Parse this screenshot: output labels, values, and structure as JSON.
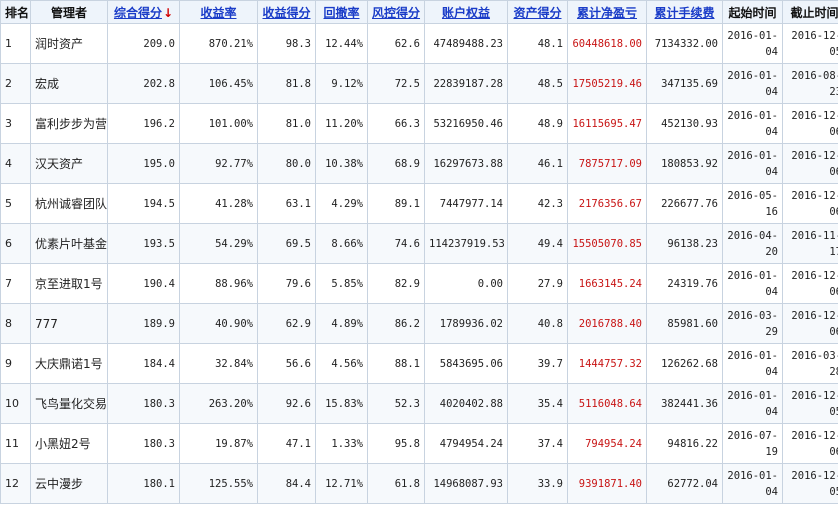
{
  "table": {
    "headers": {
      "rank": "排名",
      "manager": "管理者",
      "composite": "综合得分",
      "sort_arrow": "↓",
      "return_rate": "收益率",
      "return_score": "收益得分",
      "drawdown": "回撤率",
      "risk_score": "风控得分",
      "equity": "账户权益",
      "asset_score": "资产得分",
      "net_profit": "累计净盈亏",
      "fees": "累计手续费",
      "start": "起始时间",
      "end": "截止时间"
    },
    "rows": [
      {
        "rank": "1",
        "manager": "润时资产",
        "composite": "209.0",
        "return_rate": "870.21%",
        "return_score": "98.3",
        "drawdown": "12.44%",
        "risk_score": "62.6",
        "equity": "47489488.23",
        "asset_score": "48.1",
        "net_profit": "60448618.00",
        "fees": "7134332.00",
        "start_a": "2016-01-",
        "start_b": "04",
        "end_a": "2016-12-",
        "end_b": "05"
      },
      {
        "rank": "2",
        "manager": "宏成",
        "composite": "202.8",
        "return_rate": "106.45%",
        "return_score": "81.8",
        "drawdown": "9.12%",
        "risk_score": "72.5",
        "equity": "22839187.28",
        "asset_score": "48.5",
        "net_profit": "17505219.46",
        "fees": "347135.69",
        "start_a": "2016-01-",
        "start_b": "04",
        "end_a": "2016-08-",
        "end_b": "23"
      },
      {
        "rank": "3",
        "manager": "富利步步为营",
        "composite": "196.2",
        "return_rate": "101.00%",
        "return_score": "81.0",
        "drawdown": "11.20%",
        "risk_score": "66.3",
        "equity": "53216950.46",
        "asset_score": "48.9",
        "net_profit": "16115695.47",
        "fees": "452130.93",
        "start_a": "2016-01-",
        "start_b": "04",
        "end_a": "2016-12-",
        "end_b": "06"
      },
      {
        "rank": "4",
        "manager": "汉天资产",
        "composite": "195.0",
        "return_rate": "92.77%",
        "return_score": "80.0",
        "drawdown": "10.38%",
        "risk_score": "68.9",
        "equity": "16297673.88",
        "asset_score": "46.1",
        "net_profit": "7875717.09",
        "fees": "180853.92",
        "start_a": "2016-01-",
        "start_b": "04",
        "end_a": "2016-12-",
        "end_b": "06"
      },
      {
        "rank": "5",
        "manager": "杭州诚睿团队",
        "composite": "194.5",
        "return_rate": "41.28%",
        "return_score": "63.1",
        "drawdown": "4.29%",
        "risk_score": "89.1",
        "equity": "7447977.14",
        "asset_score": "42.3",
        "net_profit": "2176356.67",
        "fees": "226677.76",
        "start_a": "2016-05-",
        "start_b": "16",
        "end_a": "2016-12-",
        "end_b": "06"
      },
      {
        "rank": "6",
        "manager": "优素片叶基金",
        "composite": "193.5",
        "return_rate": "54.29%",
        "return_score": "69.5",
        "drawdown": "8.66%",
        "risk_score": "74.6",
        "equity": "114237919.53",
        "asset_score": "49.4",
        "net_profit": "15505070.85",
        "fees": "96138.23",
        "start_a": "2016-04-",
        "start_b": "20",
        "end_a": "2016-11-",
        "end_b": "17"
      },
      {
        "rank": "7",
        "manager": "京至进取1号",
        "composite": "190.4",
        "return_rate": "88.96%",
        "return_score": "79.6",
        "drawdown": "5.85%",
        "risk_score": "82.9",
        "equity": "0.00",
        "asset_score": "27.9",
        "net_profit": "1663145.24",
        "fees": "24319.76",
        "start_a": "2016-01-",
        "start_b": "04",
        "end_a": "2016-12-",
        "end_b": "06"
      },
      {
        "rank": "8",
        "manager": "777",
        "composite": "189.9",
        "return_rate": "40.90%",
        "return_score": "62.9",
        "drawdown": "4.89%",
        "risk_score": "86.2",
        "equity": "1789936.02",
        "asset_score": "40.8",
        "net_profit": "2016788.40",
        "fees": "85981.60",
        "start_a": "2016-03-",
        "start_b": "29",
        "end_a": "2016-12-",
        "end_b": "06"
      },
      {
        "rank": "9",
        "manager": "大庆鼎诺1号",
        "composite": "184.4",
        "return_rate": "32.84%",
        "return_score": "56.6",
        "drawdown": "4.56%",
        "risk_score": "88.1",
        "equity": "5843695.06",
        "asset_score": "39.7",
        "net_profit": "1444757.32",
        "fees": "126262.68",
        "start_a": "2016-01-",
        "start_b": "04",
        "end_a": "2016-03-",
        "end_b": "28"
      },
      {
        "rank": "10",
        "manager": "飞鸟量化交易",
        "composite": "180.3",
        "return_rate": "263.20%",
        "return_score": "92.6",
        "drawdown": "15.83%",
        "risk_score": "52.3",
        "equity": "4020402.88",
        "asset_score": "35.4",
        "net_profit": "5116048.64",
        "fees": "382441.36",
        "start_a": "2016-01-",
        "start_b": "04",
        "end_a": "2016-12-",
        "end_b": "05"
      },
      {
        "rank": "11",
        "manager": "小黑妞2号",
        "composite": "180.3",
        "return_rate": "19.87%",
        "return_score": "47.1",
        "drawdown": "1.33%",
        "risk_score": "95.8",
        "equity": "4794954.24",
        "asset_score": "37.4",
        "net_profit": "794954.24",
        "fees": "94816.22",
        "start_a": "2016-07-",
        "start_b": "19",
        "end_a": "2016-12-",
        "end_b": "06"
      },
      {
        "rank": "12",
        "manager": "云中漫步",
        "composite": "180.1",
        "return_rate": "125.55%",
        "return_score": "84.4",
        "drawdown": "12.71%",
        "risk_score": "61.8",
        "equity": "14968087.93",
        "asset_score": "33.9",
        "net_profit": "9391871.40",
        "fees": "62772.04",
        "start_a": "2016-01-",
        "start_b": "04",
        "end_a": "2016-12-",
        "end_b": "05"
      }
    ]
  },
  "colors": {
    "link": "#1a3cc8",
    "sort_arrow": "#d20000",
    "profit_text": "#c81414",
    "border": "#c8d3e0",
    "header_bg": "#eef4fb"
  },
  "icons": {
    "sort": "sort-desc-arrow-icon"
  }
}
